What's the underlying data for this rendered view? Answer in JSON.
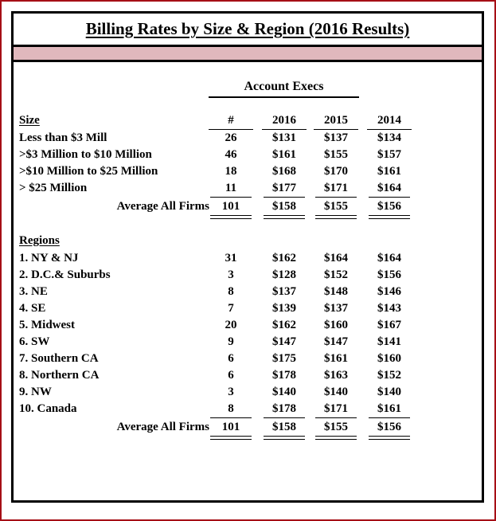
{
  "title": "Billing Rates by Size & Region (2016 Results)",
  "group_header": "Account Execs",
  "columns": {
    "count": "#",
    "y2016": "2016",
    "y2015": "2015",
    "y2014": "2014"
  },
  "sections": {
    "size": {
      "header": "Size",
      "rows": [
        {
          "label": "Less than $3 Mill",
          "count": "26",
          "y2016": "$131",
          "y2015": "$137",
          "y2014": "$134"
        },
        {
          "label": ">$3 Million to $10 Million",
          "count": "46",
          "y2016": "$161",
          "y2015": "$155",
          "y2014": "$157"
        },
        {
          "label": ">$10 Million to $25 Million",
          "count": "18",
          "y2016": "$168",
          "y2015": "$170",
          "y2014": "$161"
        },
        {
          "label": "> $25 Million",
          "count": "11",
          "y2016": "$177",
          "y2015": "$171",
          "y2014": "$164"
        }
      ],
      "total": {
        "label": "Average All Firms",
        "count": "101",
        "y2016": "$158",
        "y2015": "$155",
        "y2014": "$156"
      }
    },
    "regions": {
      "header": "Regions",
      "rows": [
        {
          "label": "1. NY & NJ",
          "count": "31",
          "y2016": "$162",
          "y2015": "$164",
          "y2014": "$164"
        },
        {
          "label": "2. D.C.& Suburbs",
          "count": "3",
          "y2016": "$128",
          "y2015": "$152",
          "y2014": "$156"
        },
        {
          "label": "3. NE",
          "count": "8",
          "y2016": "$137",
          "y2015": "$148",
          "y2014": "$146"
        },
        {
          "label": "4. SE",
          "count": "7",
          "y2016": "$139",
          "y2015": "$137",
          "y2014": "$143"
        },
        {
          "label": "5. Midwest",
          "count": "20",
          "y2016": "$162",
          "y2015": "$160",
          "y2014": "$167"
        },
        {
          "label": "6. SW",
          "count": "9",
          "y2016": "$147",
          "y2015": "$147",
          "y2014": "$141"
        },
        {
          "label": "7. Southern CA",
          "count": "6",
          "y2016": "$175",
          "y2015": "$161",
          "y2014": "$160"
        },
        {
          "label": "8. Northern CA",
          "count": "6",
          "y2016": "$178",
          "y2015": "$163",
          "y2014": "$152"
        },
        {
          "label": "9. NW",
          "count": "3",
          "y2016": "$140",
          "y2015": "$140",
          "y2014": "$140"
        },
        {
          "label": "10. Canada",
          "count": "8",
          "y2016": "$178",
          "y2015": "$171",
          "y2014": "$161"
        }
      ],
      "total": {
        "label": "Average All Firms",
        "count": "101",
        "y2016": "$158",
        "y2015": "$155",
        "y2014": "$156"
      }
    }
  },
  "colors": {
    "outer_border": "#a60f16",
    "frame": "#000000",
    "accent_band": "#e0b8bd",
    "text": "#000000",
    "background": "#ffffff"
  },
  "chart_data": {
    "type": "table",
    "title": "Billing Rates by Size & Region (2016 Results)",
    "column_group": "Account Execs",
    "columns": [
      "Size / Regions",
      "#",
      "2016",
      "2015",
      "2014"
    ],
    "rows": [
      [
        "Less than $3 Mill",
        26,
        131,
        137,
        134
      ],
      [
        ">$3 Million to $10 Million",
        46,
        161,
        155,
        157
      ],
      [
        ">$10 Million to $25 Million",
        18,
        168,
        170,
        161
      ],
      [
        "> $25 Million",
        11,
        177,
        171,
        164
      ],
      [
        "Average All Firms",
        101,
        158,
        155,
        156
      ],
      [
        "1. NY & NJ",
        31,
        162,
        164,
        164
      ],
      [
        "2. D.C.& Suburbs",
        3,
        128,
        152,
        156
      ],
      [
        "3. NE",
        8,
        137,
        148,
        146
      ],
      [
        "4. SE",
        7,
        139,
        137,
        143
      ],
      [
        "5. Midwest",
        20,
        162,
        160,
        167
      ],
      [
        "6. SW",
        9,
        147,
        147,
        141
      ],
      [
        "7. Southern CA",
        6,
        175,
        161,
        160
      ],
      [
        "8. Northern CA",
        6,
        178,
        163,
        152
      ],
      [
        "9. NW",
        3,
        140,
        140,
        140
      ],
      [
        "10. Canada",
        8,
        178,
        171,
        161
      ],
      [
        "Average All Firms",
        101,
        158,
        155,
        156
      ]
    ]
  }
}
